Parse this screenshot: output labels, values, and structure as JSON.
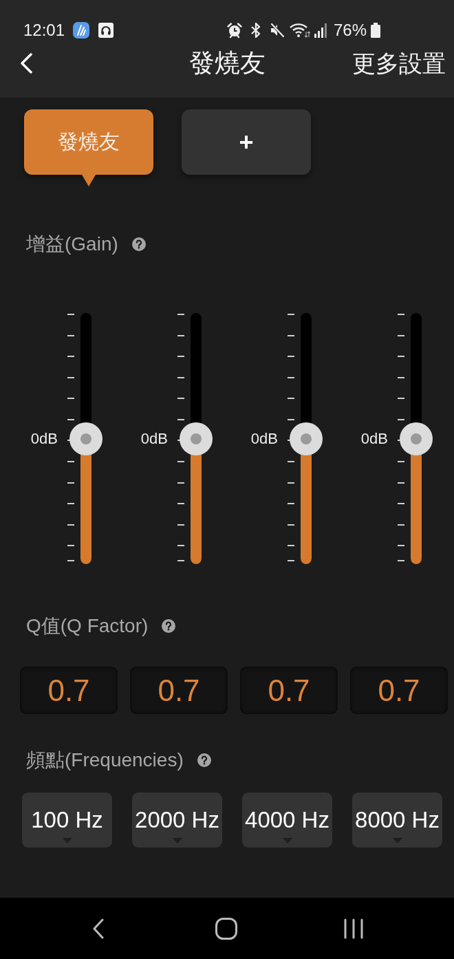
{
  "status_bar": {
    "time": "12:01",
    "battery": "76%"
  },
  "app_bar": {
    "title": "發燒友",
    "action": "更多設置"
  },
  "presets": [
    {
      "kind": "preset",
      "label": "發燒友",
      "selected": true
    },
    {
      "kind": "add",
      "label": "+",
      "selected": false
    }
  ],
  "gain": {
    "title": "增益(Gain)",
    "bands": [
      {
        "reading": "0dB",
        "level": 0.5
      },
      {
        "reading": "0dB",
        "level": 0.5
      },
      {
        "reading": "0dB",
        "level": 0.5
      },
      {
        "reading": "0dB",
        "level": 0.5
      }
    ]
  },
  "q_factor": {
    "title": "Q值(Q Factor)",
    "values": [
      "0.7",
      "0.7",
      "0.7",
      "0.7"
    ]
  },
  "frequencies": {
    "title": "頻點(Frequencies)",
    "values": [
      "100 Hz",
      "2000 Hz",
      "4000 Hz",
      "8000 Hz"
    ]
  }
}
